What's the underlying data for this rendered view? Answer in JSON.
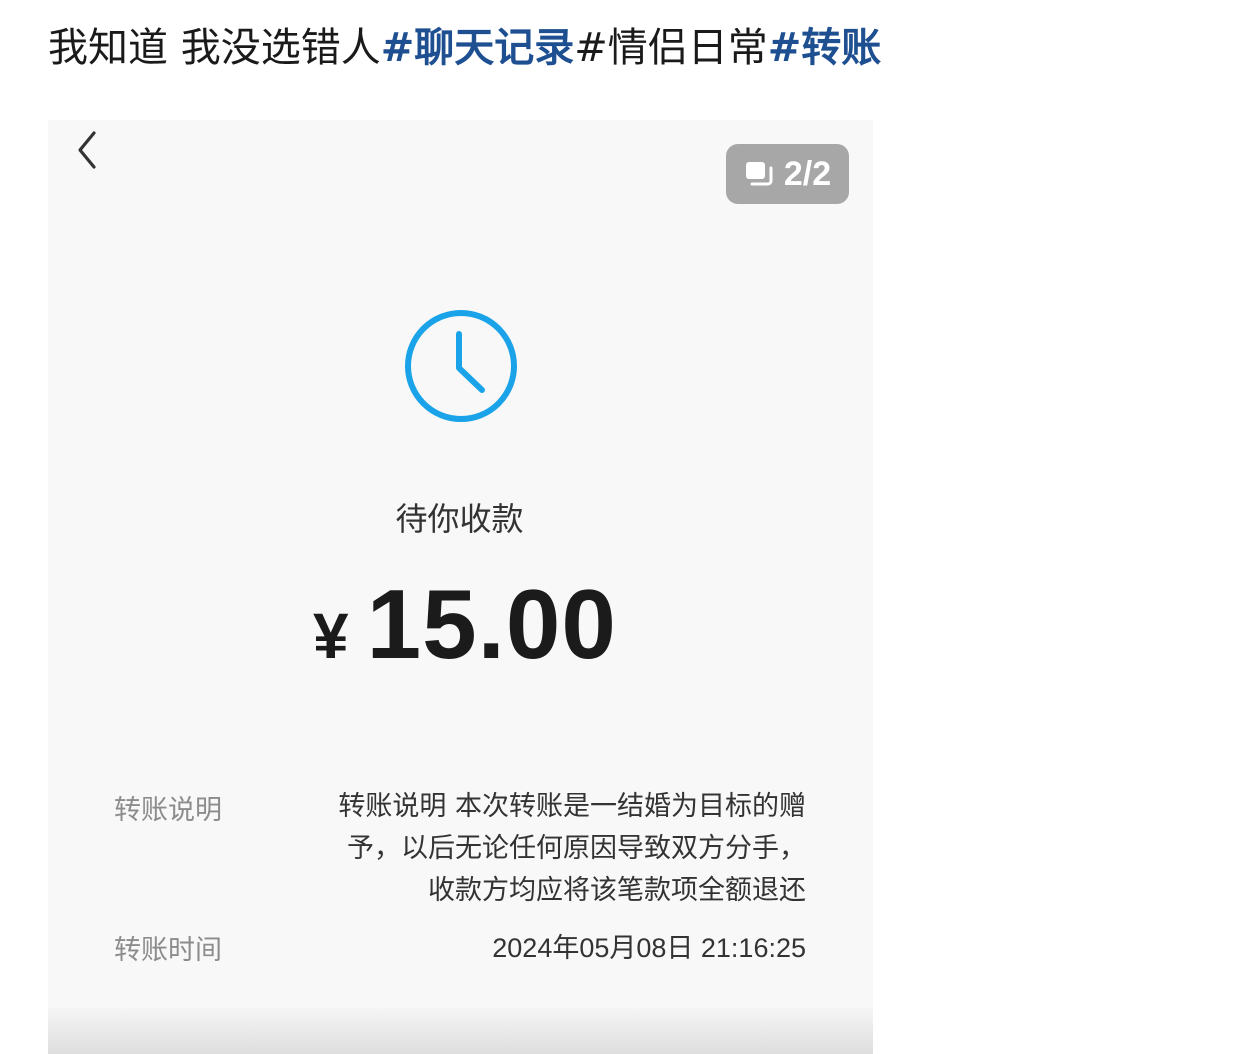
{
  "post": {
    "caption": "我知道 我没选错人",
    "tag_chat": "#聊天记录",
    "tag_couple": "#情侣日常",
    "tag_transfer": "#转账"
  },
  "viewer": {
    "back_icon": "chevron-left-icon",
    "page_counter": "2/2",
    "counter_icon": "stacked-pages-icon"
  },
  "transfer": {
    "status_icon": "clock-icon",
    "status_color": "#1aa3e8",
    "status": "待你收款",
    "currency": "¥",
    "amount": "15.00",
    "note_label": "转账说明",
    "note_lines": [
      "转账说明 本次转账是一结婚为目标的赠",
      "予，以后无论任何原因导致双方分手，",
      "收款方均应将该笔款项全额退还"
    ],
    "time_label": "转账时间",
    "time": "2024年05月08日 21:16:25"
  }
}
